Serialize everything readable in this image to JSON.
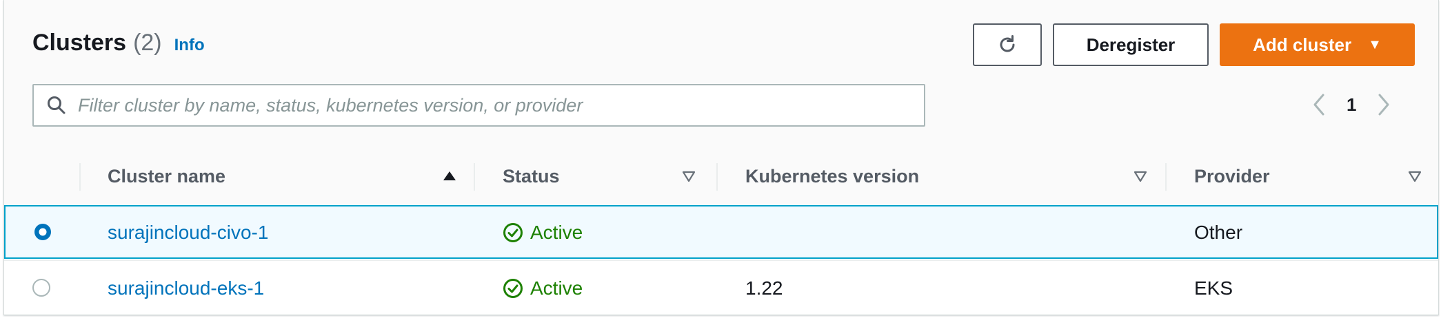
{
  "header": {
    "title": "Clusters",
    "count": "(2)",
    "info_label": "Info"
  },
  "toolbar": {
    "refresh_icon": "refresh-icon",
    "deregister_label": "Deregister",
    "add_cluster_label": "Add cluster",
    "add_cluster_caret": "▼",
    "accent_color": "#ec7211"
  },
  "search": {
    "placeholder": "Filter cluster by name, status, kubernetes version, or provider",
    "value": ""
  },
  "pagination": {
    "current_page": "1"
  },
  "table": {
    "columns": [
      {
        "label": "Cluster name",
        "sort": "ascending"
      },
      {
        "label": "Status",
        "sort": "none"
      },
      {
        "label": "Kubernetes version",
        "sort": "none"
      },
      {
        "label": "Provider",
        "sort": "none"
      }
    ],
    "rows": [
      {
        "selected": true,
        "name": "surajincloud-civo-1",
        "status": "Active",
        "version": "",
        "provider": "Other"
      },
      {
        "selected": false,
        "name": "surajincloud-eks-1",
        "status": "Active",
        "version": "1.22",
        "provider": "EKS"
      }
    ]
  },
  "colors": {
    "link": "#0073bb",
    "status_active": "#1d8102",
    "selected_row_border": "#00a1c9"
  }
}
